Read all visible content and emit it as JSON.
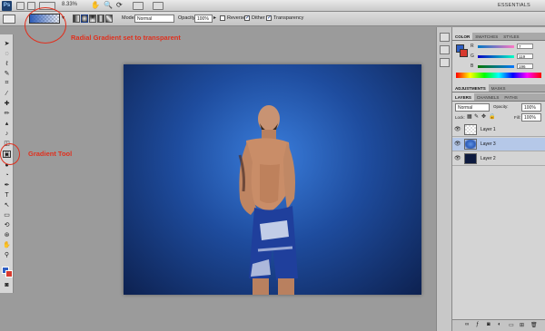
{
  "app": {
    "logo": "Ps",
    "zoom": "8.33%",
    "workspace": "ESSENTIALS"
  },
  "options": {
    "mode_label": "Mode:",
    "mode_value": "Normal",
    "opacity_label": "Opacity:",
    "opacity_value": "100%",
    "reverse_label": "Reverse",
    "reverse_checked": false,
    "dither_label": "Dither",
    "dither_checked": true,
    "transparency_label": "Transparency",
    "transparency_checked": true
  },
  "annotations": {
    "gradient_note": "Radial Gradient set to transparent",
    "tool_note": "Gradient Tool"
  },
  "color_panel": {
    "tabs": [
      "COLOR",
      "SWATCHES",
      "STYLES"
    ],
    "fg_color": "#2f5fc4",
    "bg_color": "#d83a2e",
    "r_label": "R",
    "r_value": "7",
    "g_label": "G",
    "g_value": "119",
    "b_label": "B",
    "b_value": "196"
  },
  "adjustments_panel": {
    "tabs": [
      "ADJUSTMENTS",
      "MASKS"
    ]
  },
  "layers_panel": {
    "tabs": [
      "LAYERS",
      "CHANNELS",
      "PATHS"
    ],
    "blend_mode": "Normal",
    "opacity_label": "Opacity:",
    "opacity_value": "100%",
    "lock_label": "Lock:",
    "fill_label": "Fill:",
    "fill_value": "100%",
    "layers": [
      {
        "name": "Layer 1",
        "selected": false
      },
      {
        "name": "Layer 3",
        "selected": true
      },
      {
        "name": "Layer 2",
        "selected": false
      }
    ]
  },
  "colors": {
    "accent_annotation": "#e0301e",
    "canvas_center": "#3a7ddb",
    "canvas_edge": "#0d2150"
  }
}
